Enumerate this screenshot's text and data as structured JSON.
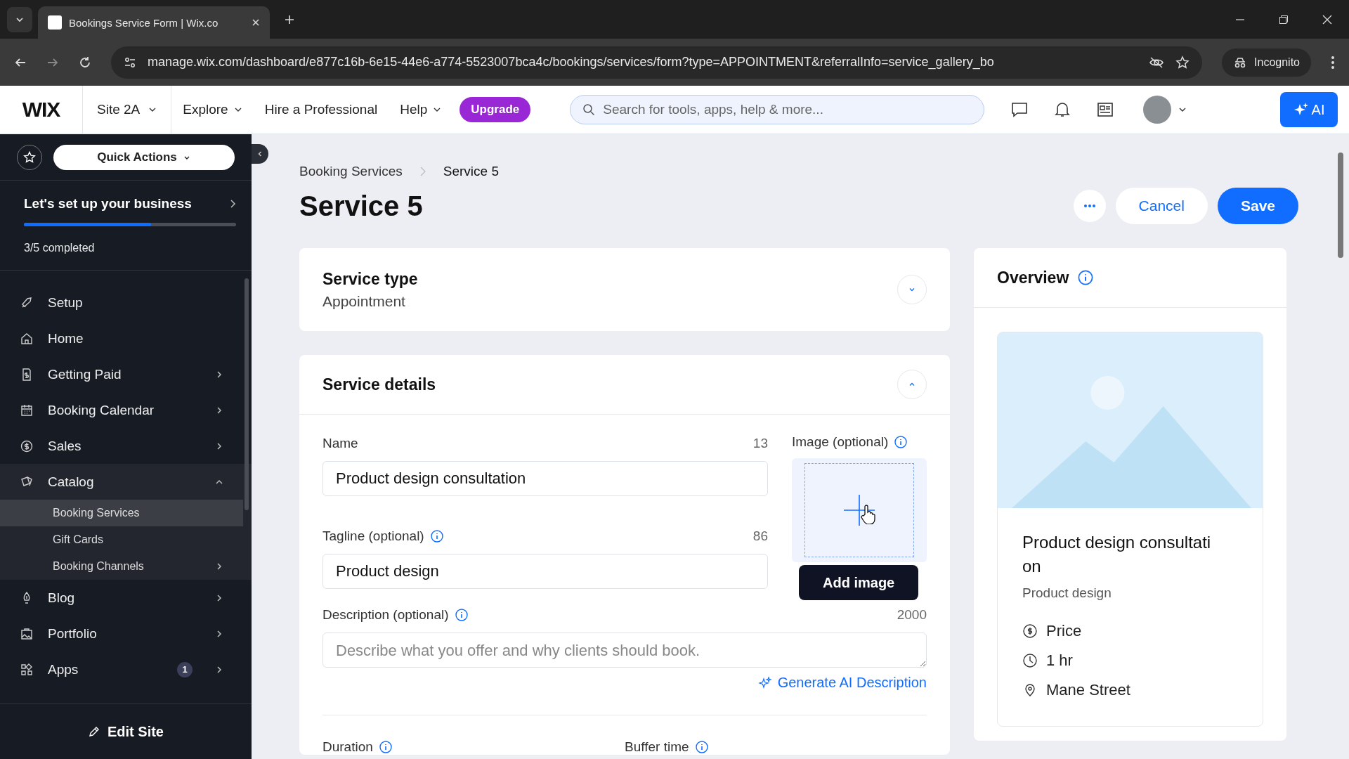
{
  "browser": {
    "tab_title": "Bookings Service Form | Wix.co",
    "url": "manage.wix.com/dashboard/e877c16b-6e15-44e6-a774-5523007bca4c/bookings/services/form?type=APPOINTMENT&referralInfo=service_gallery_bo",
    "profile": "Incognito"
  },
  "topbar": {
    "logo": "WIX",
    "site": "Site 2A",
    "nav": [
      {
        "label": "Explore",
        "dropdown": true
      },
      {
        "label": "Hire a Professional",
        "dropdown": false
      },
      {
        "label": "Help",
        "dropdown": true
      }
    ],
    "upgrade": "Upgrade",
    "search": {
      "placeholder": "Search for tools, apps, help & more..."
    },
    "ai": "AI"
  },
  "sidebar": {
    "quick_actions": "Quick Actions",
    "setup": {
      "title": "Let's set up your business",
      "level": 0.6,
      "progress": "3/5 completed"
    },
    "items": [
      {
        "label": "Setup",
        "has_chevron": false
      },
      {
        "label": "Home",
        "has_chevron": false
      },
      {
        "label": "Getting Paid",
        "has_chevron": true
      },
      {
        "label": "Booking Calendar",
        "has_chevron": true
      },
      {
        "label": "Sales",
        "has_chevron": true
      },
      {
        "label": "Catalog",
        "has_chevron": true,
        "expanded": true,
        "children": [
          {
            "label": "Booking Services",
            "selected": true,
            "has_chevron": false
          },
          {
            "label": "Gift Cards",
            "selected": false,
            "has_chevron": false
          },
          {
            "label": "Booking Channels",
            "selected": false,
            "has_chevron": true
          }
        ]
      },
      {
        "label": "Blog",
        "has_chevron": true
      },
      {
        "label": "Portfolio",
        "has_chevron": true
      },
      {
        "label": "Apps",
        "has_chevron": true,
        "badge": "1"
      }
    ],
    "edit_site": "Edit Site"
  },
  "page": {
    "breadcrumb": [
      "Booking Services",
      "Service 5"
    ],
    "title": "Service 5",
    "cancel": "Cancel",
    "save": "Save",
    "service_type": {
      "title": "Service type",
      "value": "Appointment",
      "expanded": false
    },
    "service_details": {
      "title": "Service details",
      "expanded": true,
      "name": {
        "label": "Name",
        "counter": "13",
        "value": "Product design consultation"
      },
      "tagline": {
        "label": "Tagline (optional)",
        "counter": "86",
        "value": "Product design"
      },
      "image": {
        "label": "Image (optional)",
        "tooltip": "Add image"
      },
      "description": {
        "label": "Description (optional)",
        "counter": "2000",
        "placeholder": "Describe what you offer and why clients should book."
      },
      "generate": "Generate AI Description",
      "duration": {
        "label": "Duration"
      },
      "buffer": {
        "label": "Buffer time"
      }
    },
    "overview": {
      "title": "Overview",
      "preview": {
        "title": "Product design consultation",
        "tagline": "Product design",
        "details": [
          {
            "kind": "price",
            "text": "Price"
          },
          {
            "kind": "duration",
            "text": "1 hr"
          },
          {
            "kind": "location",
            "text": "Mane Street"
          }
        ]
      }
    }
  }
}
